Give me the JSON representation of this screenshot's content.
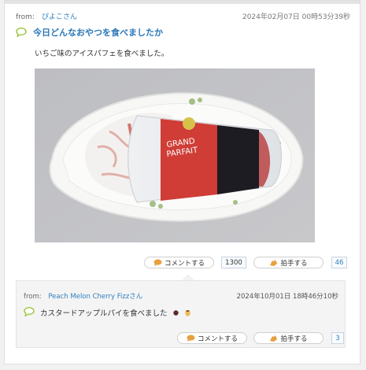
{
  "post": {
    "from_label": "from:",
    "author": "ぴよこさん",
    "timestamp": "2024年02月07日 00時53分39秒",
    "title": "今日どんなおやつを食べましたか",
    "body": "いちご味のアイスパフェを食べました。",
    "photo_alt": "GRAND PARFAIT"
  },
  "actions": {
    "comment_label": "コメントする",
    "comment_count": "1300",
    "clap_label": "拍手する",
    "clap_count": "46"
  },
  "reply": {
    "from_label": "from:",
    "author": "Peach Melon Cherry Fizzさん",
    "timestamp": "2024年10月01日 18時46分10秒",
    "body": "カスタードアップルパイを食べました",
    "comment_label": "コメントする",
    "clap_label": "拍手する",
    "clap_count": "3"
  },
  "colors": {
    "link_blue": "#2f7fbf",
    "bubble_green": "#9ac43a",
    "clap_orange": "#e8a040"
  },
  "icons": [
    "speech-bubble-icon",
    "comment-icon",
    "clap-icon",
    "chocolate-emoji-icon",
    "pudding-emoji-icon"
  ]
}
